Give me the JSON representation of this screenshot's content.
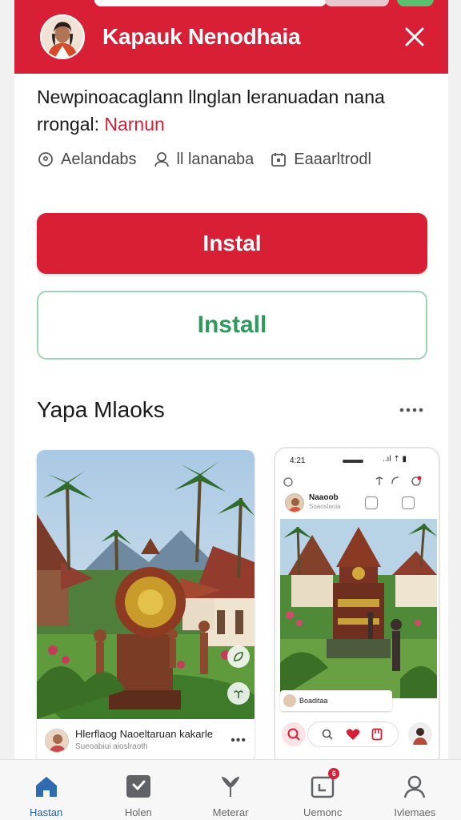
{
  "header": {
    "title": "Kapauk Nenodhaia"
  },
  "headline": {
    "text": "Newpinoacaglann llnglan leranuadan nana rrongal:",
    "accent": "Narnun"
  },
  "meta": {
    "items": [
      {
        "icon": "location-pin-icon",
        "label": "Aelandabs"
      },
      {
        "icon": "person-icon",
        "label": "ll lananaba"
      },
      {
        "icon": "calendar-icon",
        "label": "Eaaarltrodl"
      }
    ]
  },
  "buttons": {
    "primary_label": "Instal",
    "secondary_label": "Install"
  },
  "section": {
    "title": "Yapa Mlaoks"
  },
  "media_card": {
    "caption": "Hlerflaog Naoeltaruan kakarle",
    "caption_sub": "Sueoabiui aioslraoth",
    "more": "•••"
  },
  "phone_preview": {
    "time": "4:21",
    "signal": "..ıl ⇡ ▮",
    "profile_name": "Naaoob",
    "profile_sub": "Soaoslaoia",
    "caption": "Boaditaa"
  },
  "bottom_nav": {
    "items": [
      {
        "label": "Hastan",
        "icon": "home-icon",
        "active": true
      },
      {
        "label": "Holen",
        "icon": "chat-icon",
        "active": false
      },
      {
        "label": "Meterar",
        "icon": "heart-icon",
        "active": false
      },
      {
        "label": "Uemonc",
        "icon": "calendar-icon",
        "active": false,
        "badge": "6"
      },
      {
        "label": "Ivlemaes",
        "icon": "profile-icon",
        "active": false
      }
    ]
  },
  "colors": {
    "brand_red": "#d81f36",
    "install_green": "#2e9a5c",
    "nav_active": "#2a5d9c"
  }
}
